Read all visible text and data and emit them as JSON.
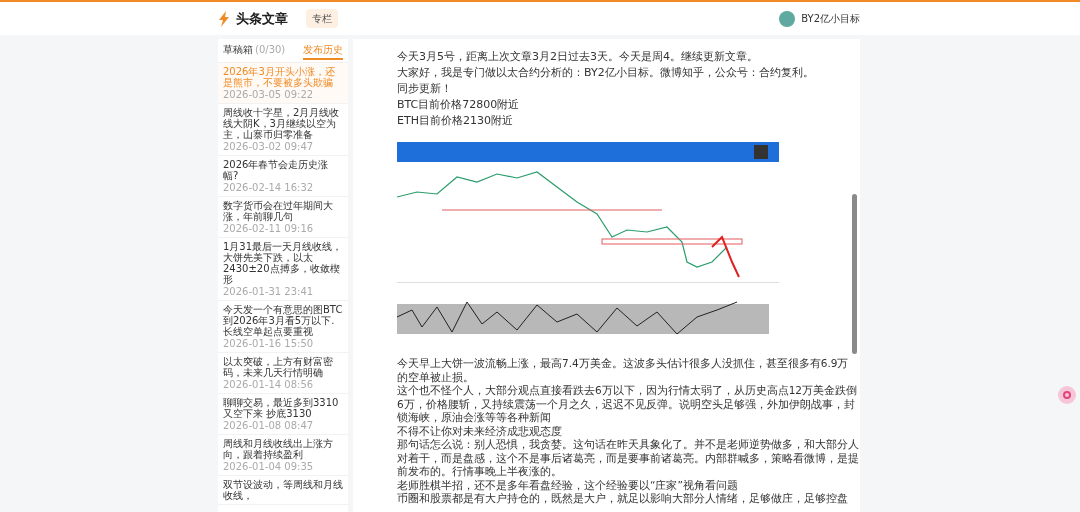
{
  "header": {
    "logo_text": "头条文章",
    "tag": "专栏",
    "user": {
      "name": "BY2亿小目标"
    }
  },
  "sidebar": {
    "tabs": [
      {
        "label": "草稿箱",
        "count": "(0/30)",
        "selected": false
      },
      {
        "label": "发布历史",
        "selected": true
      }
    ],
    "items": [
      {
        "title": "2026年3月开头小涨，还是熊市，不要被多头欺骗",
        "date": "2026-03-05 09:22",
        "selected": true
      },
      {
        "title": "周线收十字星，2月月线收线大阴K，3月继续以空为主，山寨币归零准备",
        "date": "2026-03-02 09:47",
        "selected": false
      },
      {
        "title": "2026年春节会走历史涨幅?",
        "date": "2026-02-14 16:32",
        "selected": false
      },
      {
        "title": "数字货币会在过年期间大涨，年前聊几句",
        "date": "2026-02-11 09:16",
        "selected": false
      },
      {
        "title": "1月31最后一天月线收线，大饼先美下跌，以太2430±20点搏多，收敛楔形",
        "date": "2026-01-31 23:41",
        "selected": false
      },
      {
        "title": "今天发一个有意思的图BTC到2026年3月看5万以下.长线空单起点要重视",
        "date": "2026-01-16 15:50",
        "selected": false
      },
      {
        "title": "以太突破，上方有财富密码，未来几天行情明确",
        "date": "2026-01-14 08:56",
        "selected": false
      },
      {
        "title": "聊聊交易，最近多到3310又空下来 抄底3130",
        "date": "2026-01-08 08:47",
        "selected": false
      },
      {
        "title": "周线和月线收线出上涨方向，跟着持续盈利",
        "date": "2026-01-04 09:35",
        "selected": false
      },
      {
        "title": "双节设波动，等周线和月线收线，",
        "selected": false
      }
    ]
  },
  "article": {
    "intro": [
      "今天3月5号，距离上次文章3月2日过去3天。今天是周4。继续更新文章。",
      "大家好，我是专门做以太合约分析的：BY2亿小目标。微博知乎，公众号：合约复利。同步更新！",
      "BTC目前价格72800附近",
      "ETH目前价格2130附近"
    ],
    "body": [
      "今天早上大饼一波流畅上涨，最高7.4万美金。这波多头估计很多人没抓住，甚至很多有6.9万的空单被止损。",
      "这个也不怪个人，大部分观点直接看跌去6万以下，因为行情太弱了，从历史高点12万美金跌倒6万，价格腰斩，又持续震荡一个月之久，迟迟不见反弹。说明空头足够强，外加伊朗战事，封锁海峡，原油会涨等等各种新闻",
      "不得不让你对未来经济成悲观态度",
      "那句话怎么说：别人恐惧，我贪婪。这句话在昨天具象化了。并不是老师逆势做多，和大部分人对着干，而是盘感，这个不是事后诸葛亮，而是要事前诸葛亮。内部群喊多，策略看微博，是提前发布的。行情事晚上半夜涨的。",
      "老师胜棋半招，还不是多年看盘经验，这个经验要以“庄家”视角看问题",
      "币圈和股票都是有大户持仓的，既然是大户，就足以影响大部分人情绪，足够做庄，足够控盘"
    ]
  }
}
